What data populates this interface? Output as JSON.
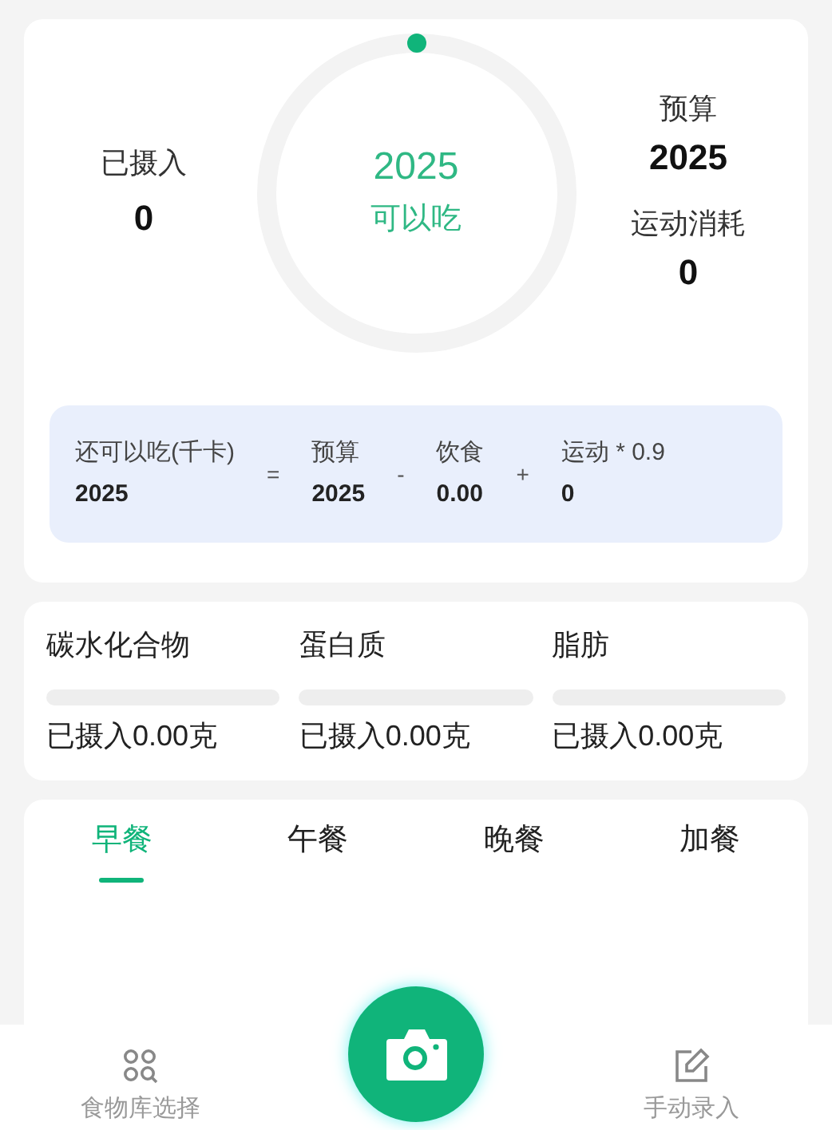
{
  "summary": {
    "intake": {
      "label": "已摄入",
      "value": "0"
    },
    "ring": {
      "value": "2025",
      "label": "可以吃"
    },
    "budget": {
      "label": "预算",
      "value": "2025"
    },
    "exercise": {
      "label": "运动消耗",
      "value": "0"
    },
    "formula": [
      {
        "kind": "term",
        "label": "还可以吃(千卡)",
        "value": "2025"
      },
      {
        "kind": "operator",
        "symbol": "="
      },
      {
        "kind": "term",
        "label": "预算",
        "value": "2025"
      },
      {
        "kind": "operator",
        "symbol": "-"
      },
      {
        "kind": "term",
        "label": "饮食",
        "value": "0.00"
      },
      {
        "kind": "operator",
        "symbol": "+"
      },
      {
        "kind": "term",
        "label": "运动 * 0.9",
        "value": "0"
      }
    ]
  },
  "macros": [
    {
      "name": "碳水化合物",
      "level": 0,
      "reading": "已摄入0.00克"
    },
    {
      "name": "蛋白质",
      "level": 0,
      "reading": "已摄入0.00克"
    },
    {
      "name": "脂肪",
      "level": 0,
      "reading": "已摄入0.00克"
    }
  ],
  "meal_tabs": [
    {
      "label": "早餐",
      "selected": true
    },
    {
      "label": "午餐",
      "selected": false
    },
    {
      "label": "晚餐",
      "selected": false
    },
    {
      "label": "加餐",
      "selected": false
    }
  ],
  "bottom_bar": {
    "left": {
      "label": "食物库选择"
    },
    "right": {
      "label": "手动录入"
    }
  }
}
